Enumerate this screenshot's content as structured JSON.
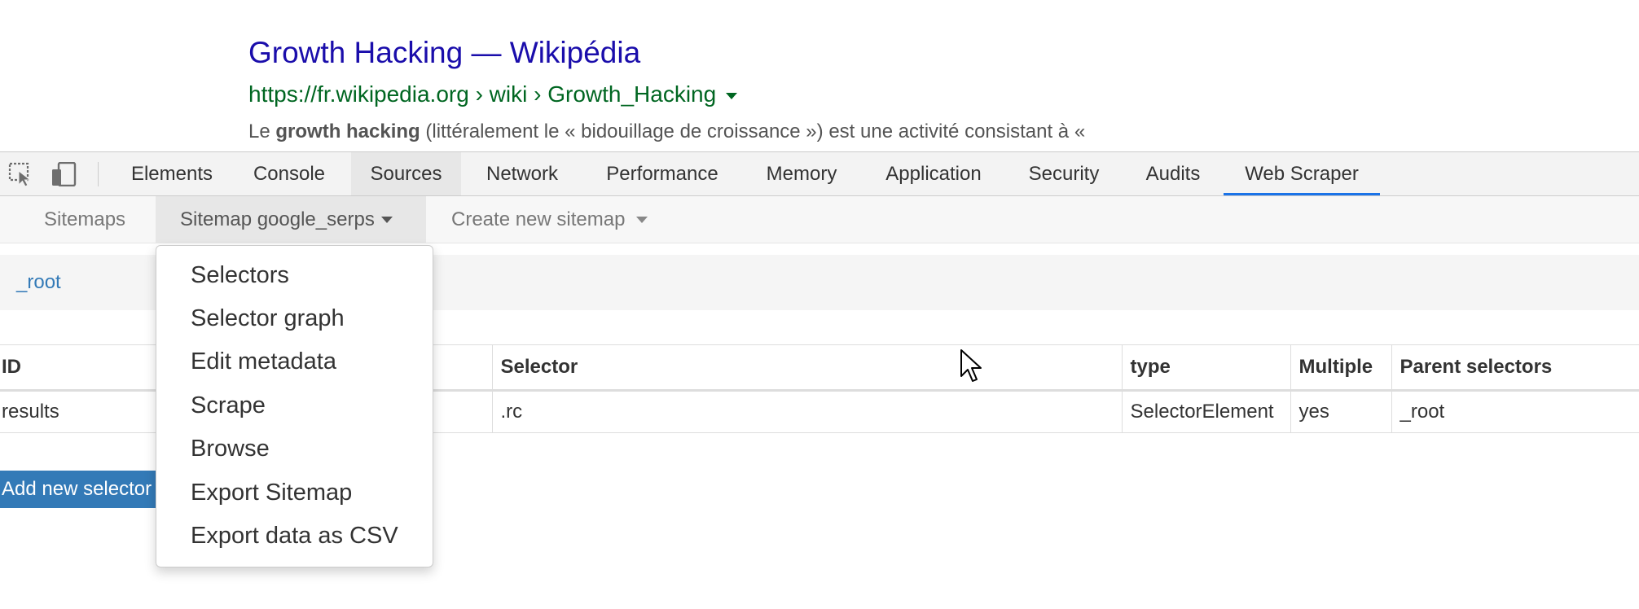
{
  "result": {
    "title": "Growth Hacking — Wikipédia",
    "url": "https://fr.wikipedia.org › wiki › Growth_Hacking",
    "snippet_prefix": "Le ",
    "snippet_bold": "growth hacking",
    "snippet_rest": " (littéralement le « bidouillage de croissance ») est une activité consistant à «"
  },
  "devtools": {
    "tabs": [
      "Elements",
      "Console",
      "Sources",
      "Network",
      "Performance",
      "Memory",
      "Application",
      "Security",
      "Audits",
      "Web Scraper"
    ],
    "hovered_tab": "Sources",
    "active_tab": "Web Scraper",
    "accent_color": "#1a73e8"
  },
  "subnav": {
    "sitemaps": "Sitemaps",
    "current_sitemap": "Sitemap google_serps",
    "create_new": "Create new sitemap"
  },
  "breadcrumb": {
    "root": "_root"
  },
  "table": {
    "headers": [
      "ID",
      "Selector",
      "type",
      "Multiple",
      "Parent selectors"
    ],
    "rows": [
      [
        "results",
        ".rc",
        "SelectorElement",
        "yes",
        "_root"
      ]
    ]
  },
  "add_button": "Add new selector",
  "dropdown": {
    "items": [
      "Selectors",
      "Selector graph",
      "Edit metadata",
      "Scrape",
      "Browse",
      "Export Sitemap",
      "Export data as CSV"
    ]
  },
  "icons": {
    "inspect": "inspect-element-icon",
    "device": "device-toolbar-icon",
    "cursor": "mouse-pointer-icon"
  }
}
